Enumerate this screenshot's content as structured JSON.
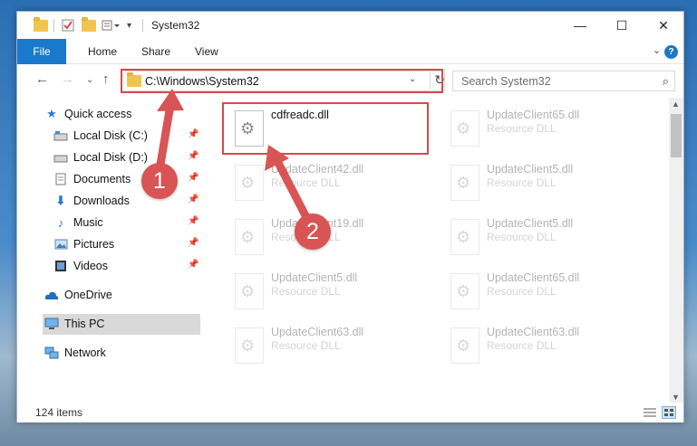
{
  "titlebar": {
    "title": "System32",
    "minimize": "—",
    "maximize": "☐",
    "close": "✕"
  },
  "ribbon": {
    "tabs": [
      "File",
      "Home",
      "Share",
      "View"
    ],
    "expand": "⌄",
    "help": "?"
  },
  "nav": {
    "back": "←",
    "forward": "→",
    "recent": "⌄",
    "up": "↑",
    "address": "C:\\Windows\\System32",
    "dropdown": "⌄",
    "refresh": "↻",
    "search_placeholder": "Search System32"
  },
  "sidebar": {
    "quick_access": "Quick access",
    "items": [
      {
        "label": "Local Disk (C:)",
        "icon": "drive-icon"
      },
      {
        "label": "Local Disk (D:)",
        "icon": "drive-icon"
      },
      {
        "label": "Documents",
        "icon": "documents-icon"
      },
      {
        "label": "Downloads",
        "icon": "downloads-icon"
      },
      {
        "label": "Music",
        "icon": "music-icon"
      },
      {
        "label": "Pictures",
        "icon": "pictures-icon"
      },
      {
        "label": "Videos",
        "icon": "videos-icon"
      }
    ],
    "onedrive": "OneDrive",
    "this_pc": "This PC",
    "network": "Network"
  },
  "files": [
    {
      "name": "cdfreadc.dll",
      "type": ""
    },
    {
      "name": "UpdateClient65.dll",
      "type": "Resource DLL"
    },
    {
      "name": "UpdateClient42.dll",
      "type": "Resource DLL"
    },
    {
      "name": "UpdateClient5.dll",
      "type": "Resource DLL"
    },
    {
      "name": "UpdateClient19.dll",
      "type": "Resource DLL"
    },
    {
      "name": "UpdateClient5.dll",
      "type": "Resource DLL"
    },
    {
      "name": "UpdateClient5.dll",
      "type": "Resource DLL"
    },
    {
      "name": "UpdateClient65.dll",
      "type": "Resource DLL"
    },
    {
      "name": "UpdateClient63.dll",
      "type": "Resource DLL"
    },
    {
      "name": "UpdateClient63.dll",
      "type": "Resource DLL"
    }
  ],
  "status": {
    "count": "124 items"
  },
  "callouts": [
    "1",
    "2"
  ],
  "colors": {
    "accent": "#1979ca",
    "highlight": "#d64a4a",
    "badge": "#d95454"
  }
}
